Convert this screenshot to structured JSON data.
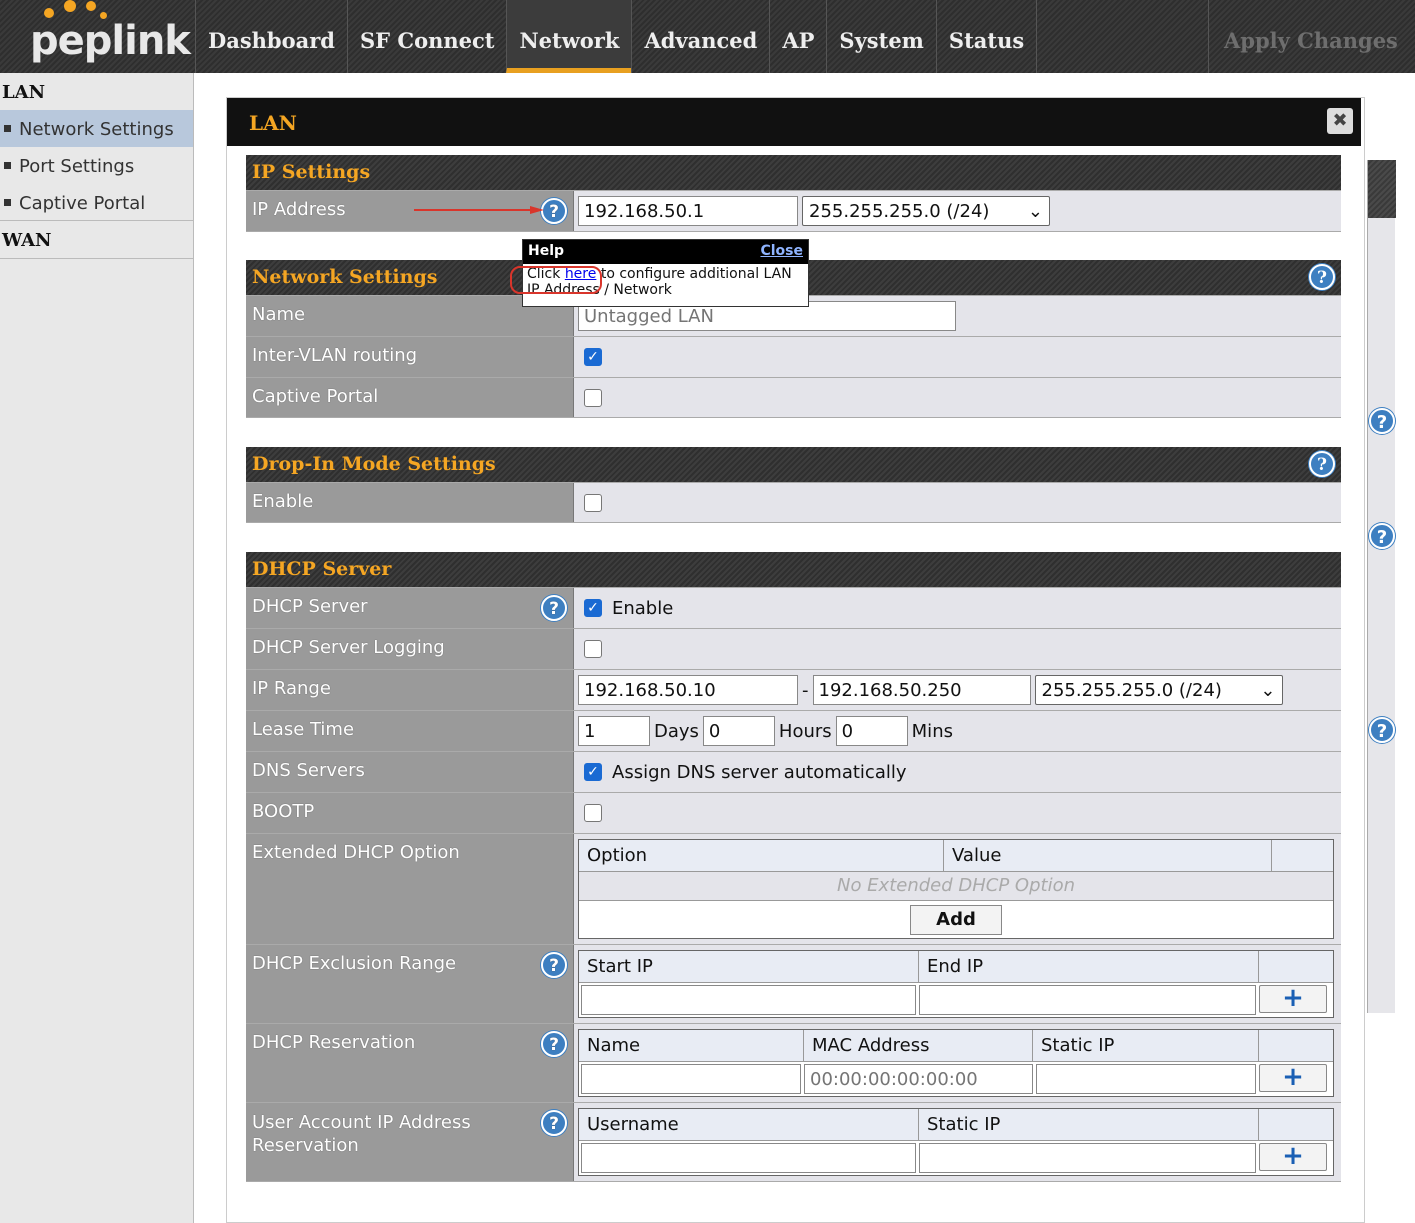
{
  "brand": {
    "name": "peplink",
    "colors": {
      "accent": "#f5a623",
      "link": "#1a5fb4"
    }
  },
  "nav": {
    "tabs": [
      "Dashboard",
      "SF Connect",
      "Network",
      "Advanced",
      "AP",
      "System",
      "Status"
    ],
    "active": "Network",
    "apply": "Apply Changes"
  },
  "sidebar": {
    "lan_heading": "LAN",
    "items": [
      "Network Settings",
      "Port Settings",
      "Captive Portal"
    ],
    "active": "Network Settings",
    "wan_heading": "WAN"
  },
  "dialog": {
    "title": "LAN",
    "close_icon": "close-icon"
  },
  "ip_settings": {
    "heading": "IP Settings",
    "ip_label": "IP Address",
    "ip_value": "192.168.50.1",
    "mask_value": "255.255.255.0 (/24)"
  },
  "help_popup": {
    "title": "Help",
    "close": "Close",
    "text_before": "Click ",
    "link": "here",
    "text_after": " to configure additional LAN IP Address / Network"
  },
  "network_settings": {
    "heading": "Network Settings",
    "name_label": "Name",
    "name_placeholder": "Untagged LAN",
    "intervlan_label": "Inter-VLAN routing",
    "intervlan_checked": true,
    "captive_label": "Captive Portal",
    "captive_checked": false
  },
  "dropin": {
    "heading": "Drop-In Mode Settings",
    "enable_label": "Enable",
    "enable_checked": false
  },
  "dhcp": {
    "heading": "DHCP Server",
    "server_label": "DHCP Server",
    "server_enable_text": "Enable",
    "logging_label": "DHCP Server Logging",
    "range_label": "IP Range",
    "range_start": "192.168.50.10",
    "range_sep": "-",
    "range_end": "192.168.50.250",
    "range_mask": "255.255.255.0 (/24)",
    "lease_label": "Lease Time",
    "lease_days": "1",
    "days_text": "Days",
    "lease_hours": "0",
    "hours_text": "Hours",
    "lease_mins": "0",
    "mins_text": "Mins",
    "dns_label": "DNS Servers",
    "dns_text": "Assign DNS server automatically",
    "bootp_label": "BOOTP",
    "ext_label": "Extended DHCP Option",
    "ext_cols": [
      "Option",
      "Value"
    ],
    "ext_empty": "No Extended DHCP Option",
    "ext_add": "Add",
    "excl_label": "DHCP Exclusion Range",
    "excl_cols": [
      "Start IP",
      "End IP"
    ],
    "resv_label": "DHCP Reservation",
    "resv_cols": [
      "Name",
      "MAC Address",
      "Static IP"
    ],
    "resv_mac_placeholder": "00:00:00:00:00:00",
    "user_label": "User Account IP Address Reservation",
    "user_cols": [
      "Username",
      "Static IP"
    ],
    "plus": "+"
  }
}
